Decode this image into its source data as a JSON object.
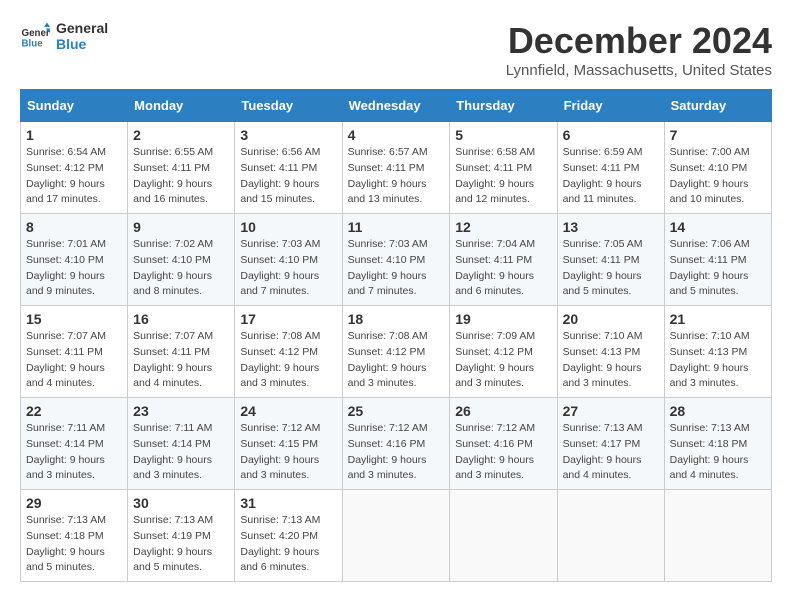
{
  "logo": {
    "line1": "General",
    "line2": "Blue"
  },
  "title": "December 2024",
  "location": "Lynnfield, Massachusetts, United States",
  "days_of_week": [
    "Sunday",
    "Monday",
    "Tuesday",
    "Wednesday",
    "Thursday",
    "Friday",
    "Saturday"
  ],
  "weeks": [
    [
      {
        "day": "1",
        "sunrise": "6:54 AM",
        "sunset": "4:12 PM",
        "daylight": "9 hours and 17 minutes."
      },
      {
        "day": "2",
        "sunrise": "6:55 AM",
        "sunset": "4:11 PM",
        "daylight": "9 hours and 16 minutes."
      },
      {
        "day": "3",
        "sunrise": "6:56 AM",
        "sunset": "4:11 PM",
        "daylight": "9 hours and 15 minutes."
      },
      {
        "day": "4",
        "sunrise": "6:57 AM",
        "sunset": "4:11 PM",
        "daylight": "9 hours and 13 minutes."
      },
      {
        "day": "5",
        "sunrise": "6:58 AM",
        "sunset": "4:11 PM",
        "daylight": "9 hours and 12 minutes."
      },
      {
        "day": "6",
        "sunrise": "6:59 AM",
        "sunset": "4:11 PM",
        "daylight": "9 hours and 11 minutes."
      },
      {
        "day": "7",
        "sunrise": "7:00 AM",
        "sunset": "4:10 PM",
        "daylight": "9 hours and 10 minutes."
      }
    ],
    [
      {
        "day": "8",
        "sunrise": "7:01 AM",
        "sunset": "4:10 PM",
        "daylight": "9 hours and 9 minutes."
      },
      {
        "day": "9",
        "sunrise": "7:02 AM",
        "sunset": "4:10 PM",
        "daylight": "9 hours and 8 minutes."
      },
      {
        "day": "10",
        "sunrise": "7:03 AM",
        "sunset": "4:10 PM",
        "daylight": "9 hours and 7 minutes."
      },
      {
        "day": "11",
        "sunrise": "7:03 AM",
        "sunset": "4:10 PM",
        "daylight": "9 hours and 7 minutes."
      },
      {
        "day": "12",
        "sunrise": "7:04 AM",
        "sunset": "4:11 PM",
        "daylight": "9 hours and 6 minutes."
      },
      {
        "day": "13",
        "sunrise": "7:05 AM",
        "sunset": "4:11 PM",
        "daylight": "9 hours and 5 minutes."
      },
      {
        "day": "14",
        "sunrise": "7:06 AM",
        "sunset": "4:11 PM",
        "daylight": "9 hours and 5 minutes."
      }
    ],
    [
      {
        "day": "15",
        "sunrise": "7:07 AM",
        "sunset": "4:11 PM",
        "daylight": "9 hours and 4 minutes."
      },
      {
        "day": "16",
        "sunrise": "7:07 AM",
        "sunset": "4:11 PM",
        "daylight": "9 hours and 4 minutes."
      },
      {
        "day": "17",
        "sunrise": "7:08 AM",
        "sunset": "4:12 PM",
        "daylight": "9 hours and 3 minutes."
      },
      {
        "day": "18",
        "sunrise": "7:08 AM",
        "sunset": "4:12 PM",
        "daylight": "9 hours and 3 minutes."
      },
      {
        "day": "19",
        "sunrise": "7:09 AM",
        "sunset": "4:12 PM",
        "daylight": "9 hours and 3 minutes."
      },
      {
        "day": "20",
        "sunrise": "7:10 AM",
        "sunset": "4:13 PM",
        "daylight": "9 hours and 3 minutes."
      },
      {
        "day": "21",
        "sunrise": "7:10 AM",
        "sunset": "4:13 PM",
        "daylight": "9 hours and 3 minutes."
      }
    ],
    [
      {
        "day": "22",
        "sunrise": "7:11 AM",
        "sunset": "4:14 PM",
        "daylight": "9 hours and 3 minutes."
      },
      {
        "day": "23",
        "sunrise": "7:11 AM",
        "sunset": "4:14 PM",
        "daylight": "9 hours and 3 minutes."
      },
      {
        "day": "24",
        "sunrise": "7:12 AM",
        "sunset": "4:15 PM",
        "daylight": "9 hours and 3 minutes."
      },
      {
        "day": "25",
        "sunrise": "7:12 AM",
        "sunset": "4:16 PM",
        "daylight": "9 hours and 3 minutes."
      },
      {
        "day": "26",
        "sunrise": "7:12 AM",
        "sunset": "4:16 PM",
        "daylight": "9 hours and 3 minutes."
      },
      {
        "day": "27",
        "sunrise": "7:13 AM",
        "sunset": "4:17 PM",
        "daylight": "9 hours and 4 minutes."
      },
      {
        "day": "28",
        "sunrise": "7:13 AM",
        "sunset": "4:18 PM",
        "daylight": "9 hours and 4 minutes."
      }
    ],
    [
      {
        "day": "29",
        "sunrise": "7:13 AM",
        "sunset": "4:18 PM",
        "daylight": "9 hours and 5 minutes."
      },
      {
        "day": "30",
        "sunrise": "7:13 AM",
        "sunset": "4:19 PM",
        "daylight": "9 hours and 5 minutes."
      },
      {
        "day": "31",
        "sunrise": "7:13 AM",
        "sunset": "4:20 PM",
        "daylight": "9 hours and 6 minutes."
      },
      null,
      null,
      null,
      null
    ]
  ],
  "labels": {
    "sunrise": "Sunrise:",
    "sunset": "Sunset:",
    "daylight": "Daylight:"
  }
}
